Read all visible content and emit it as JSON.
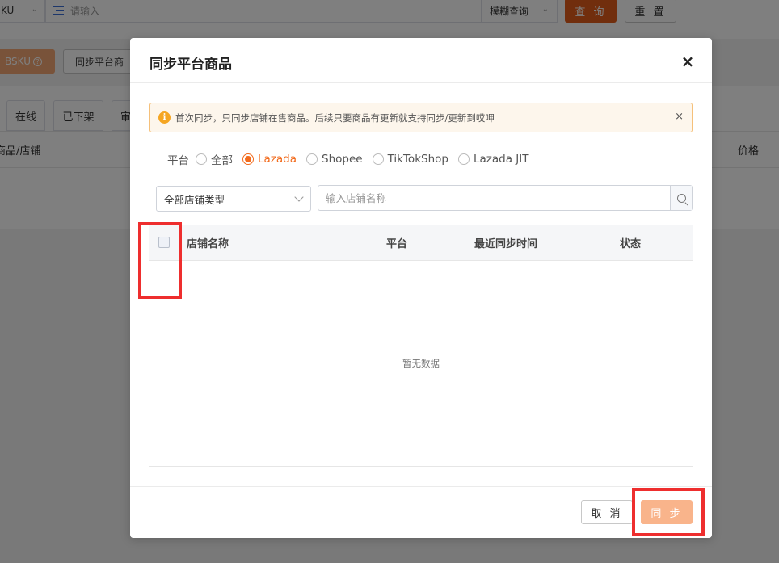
{
  "background": {
    "search_field_select": "KU",
    "search_placeholder": "请输入",
    "match_mode": "模糊查询",
    "query_label": "查 询",
    "reset_label": "重 置",
    "sku_button_label": "BSKU",
    "sync_button_label": "同步平台商",
    "tabs": [
      "在线",
      "已下架",
      "审"
    ],
    "col_product_store": "商品/店铺",
    "col_price": "价格"
  },
  "modal": {
    "title": "同步平台商品",
    "close_glyph": "×",
    "alert": {
      "icon": "info-icon",
      "text": "首次同步，只同步店铺在售商品。后续只要商品有更新就支持同步/更新到哎呷",
      "close_glyph": "×"
    },
    "platform": {
      "label": "平台",
      "options": [
        {
          "label": "全部",
          "checked": false
        },
        {
          "label": "Lazada",
          "checked": true
        },
        {
          "label": "Shopee",
          "checked": false
        },
        {
          "label": "TikTokShop",
          "checked": false
        },
        {
          "label": "Lazada JIT",
          "checked": false
        }
      ]
    },
    "store_type_select": "全部店铺类型",
    "store_search_placeholder": "输入店铺名称",
    "table": {
      "columns": [
        "店铺名称",
        "平台",
        "最近同步时间",
        "状态"
      ],
      "empty_text": "暂无数据"
    },
    "cancel_label": "取 消",
    "sync_label": "同 步"
  },
  "colors": {
    "accent": "#f26b1d",
    "query_button": "#e25c1a",
    "sync_button_disabled": "#f9b48b",
    "highlight": "#ee2e2e"
  }
}
